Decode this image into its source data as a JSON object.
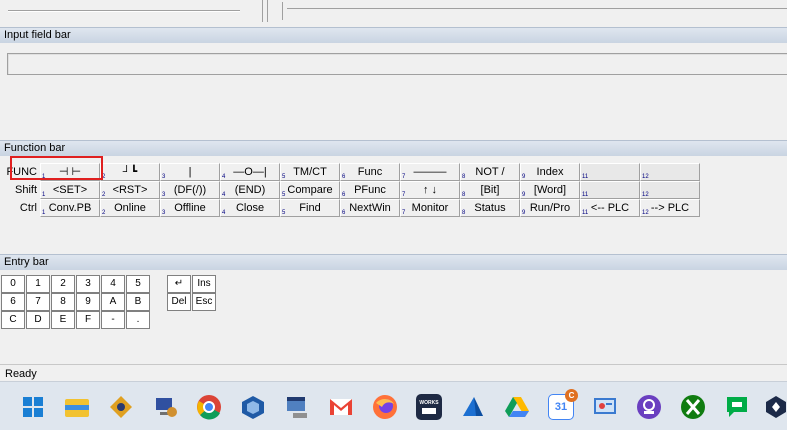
{
  "input_bar": {
    "title": "Input field bar"
  },
  "function_bar": {
    "title": "Function bar",
    "rows": [
      {
        "label": "FUNC",
        "keys": [
          "⊣ ⊢",
          "┘┗",
          "|",
          "—O—|",
          "TM/CT",
          "Func",
          "———",
          "NOT /",
          "Index",
          "",
          ""
        ]
      },
      {
        "label": "Shift",
        "keys": [
          "<SET>",
          "<RST>",
          "(DF(/))",
          "(END)",
          "Compare",
          "PFunc",
          "↑ ↓",
          "[Bit]",
          "[Word]",
          "",
          ""
        ]
      },
      {
        "label": "Ctrl",
        "keys": [
          "Conv.PB",
          "Online",
          "Offline",
          "Close",
          "Find",
          "NextWin",
          "Monitor",
          "Status",
          "Run/Pro",
          "<-- PLC",
          "--> PLC"
        ]
      }
    ],
    "key_numbers": [
      "1",
      "2",
      "3",
      "4",
      "5",
      "6",
      "7",
      "8",
      "9",
      "11",
      "12"
    ]
  },
  "entry_bar": {
    "title": "Entry bar",
    "keys": [
      [
        "0",
        "1",
        "2",
        "3",
        "4",
        "5"
      ],
      [
        "6",
        "7",
        "8",
        "9",
        "A",
        "B"
      ],
      [
        "C",
        "D",
        "E",
        "F",
        "-",
        "."
      ]
    ],
    "enter": "↵",
    "ins": "Ins",
    "del": "Del",
    "esc": "Esc"
  },
  "status": {
    "text": "Ready"
  },
  "taskbar": {
    "icons": [
      "windows-start",
      "file-explorer",
      "network-app",
      "remote-desktop",
      "chrome",
      "virtualbox",
      "system-network",
      "gmail",
      "firefox",
      "works-app",
      "cloud-app",
      "google-drive",
      "calendar",
      "control-panel",
      "profile-app",
      "xbox",
      "google-chat",
      "vpn-app"
    ],
    "calendar_day": "31",
    "calendar_badge": "C",
    "works_label": "WORKS"
  }
}
